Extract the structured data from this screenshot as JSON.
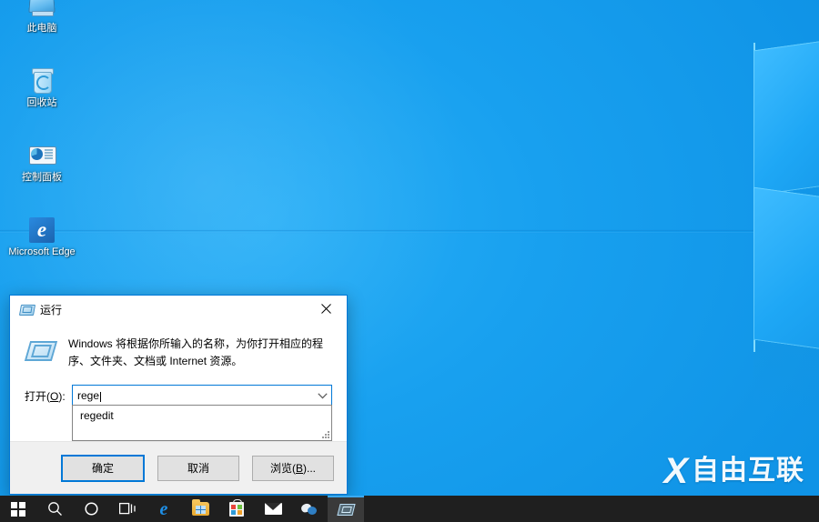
{
  "desktop": {
    "icons": [
      {
        "label": "此电脑",
        "icon": "this-pc-icon"
      },
      {
        "label": "回收站",
        "icon": "recycle-bin-icon"
      },
      {
        "label": "控制面板",
        "icon": "control-panel-icon"
      },
      {
        "label": "Microsoft Edge",
        "icon": "microsoft-edge-icon"
      }
    ],
    "wallpaper_color": "#1ba4f2"
  },
  "watermark": {
    "logo": "x-logo",
    "text": "自由互联"
  },
  "run_dialog": {
    "title": "运行",
    "title_icon": "run-window-icon",
    "close_label": "✕",
    "description": "Windows 将根据你所输入的名称，为你打开相应的程序、文件夹、文档或 Internet 资源。",
    "open_label_prefix": "打开(",
    "open_label_accel": "O",
    "open_label_suffix": "):",
    "input_value": "rege",
    "input_placeholder": "",
    "dropdown": {
      "open": true,
      "items": [
        "regedit"
      ]
    },
    "buttons": {
      "ok": "确定",
      "cancel": "取消",
      "browse_prefix": "浏览(",
      "browse_accel": "B",
      "browse_suffix": ")..."
    },
    "accent_color": "#0078d7",
    "footer_color": "#f0f0f0"
  },
  "taskbar": {
    "background": "#1f1f1f",
    "items": [
      {
        "name": "start-button",
        "icon": "windows-logo-icon",
        "active": false
      },
      {
        "name": "search-button",
        "icon": "search-icon",
        "active": false
      },
      {
        "name": "cortana-button",
        "icon": "cortana-circle-icon",
        "active": false
      },
      {
        "name": "task-view-button",
        "icon": "task-view-icon",
        "active": false
      },
      {
        "name": "edge-taskbar-button",
        "icon": "edge-icon",
        "active": false
      },
      {
        "name": "file-explorer-taskbar-button",
        "icon": "folder-icon",
        "active": false
      },
      {
        "name": "store-taskbar-button",
        "icon": "store-icon",
        "active": false
      },
      {
        "name": "mail-taskbar-button",
        "icon": "mail-icon",
        "active": false
      },
      {
        "name": "misc-taskbar-button",
        "icon": "network-icon",
        "active": false
      },
      {
        "name": "run-taskbar-button",
        "icon": "run-window-icon",
        "active": true
      }
    ]
  }
}
